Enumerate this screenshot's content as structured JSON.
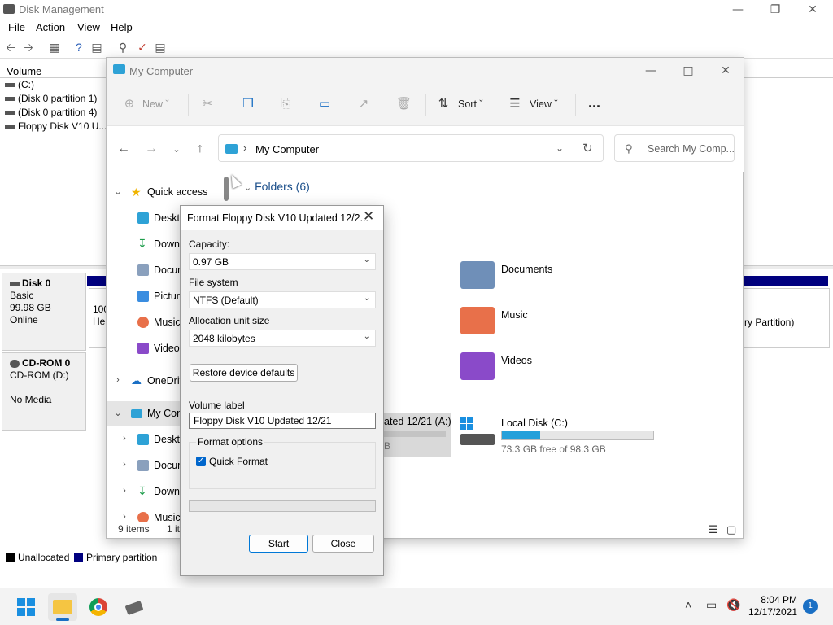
{
  "disk_management": {
    "title": "Disk Management",
    "menu": [
      "File",
      "Action",
      "View",
      "Help"
    ],
    "volume_header": "Volume",
    "volumes": [
      "(C:)",
      "(Disk 0 partition 1)",
      "(Disk 0 partition 4)",
      "Floppy Disk V10 U..."
    ],
    "disks": [
      {
        "name": "Disk 0",
        "type": "Basic",
        "size": "99.98 GB",
        "status": "Online"
      },
      {
        "name": "CD-ROM 0",
        "type": "CD-ROM (D:)",
        "size": "",
        "status": "No Media"
      }
    ],
    "partition_fragment_size": "100",
    "partition_fragment_status": "He",
    "partition_right_label": "ry Partition)",
    "legend": {
      "unallocated": "Unallocated",
      "primary": "Primary partition"
    },
    "colors": {
      "unallocated": "#000000",
      "primary": "#00007f"
    }
  },
  "explorer": {
    "title": "My Computer",
    "commands": {
      "new": "New",
      "sort": "Sort",
      "view": "View",
      "more": "..."
    },
    "address": {
      "location": "My Computer"
    },
    "search_placeholder": "Search My Comp...",
    "nav": [
      {
        "label": "Quick access",
        "icon": "star-icon"
      },
      {
        "label": "Deskto",
        "icon": "desktop-icon"
      },
      {
        "label": "Down",
        "icon": "download-icon"
      },
      {
        "label": "Docum",
        "icon": "document-icon"
      },
      {
        "label": "Pictur",
        "icon": "picture-icon"
      },
      {
        "label": "Music",
        "icon": "music-icon"
      },
      {
        "label": "Videos",
        "icon": "video-icon"
      },
      {
        "label": "OneDrive",
        "icon": "cloud-icon"
      },
      {
        "label": "My Con",
        "icon": "computer-icon"
      },
      {
        "label": "Deskto",
        "icon": "desktop-icon"
      },
      {
        "label": "Docum",
        "icon": "document-icon"
      },
      {
        "label": "Down",
        "icon": "download-icon"
      },
      {
        "label": "Music",
        "icon": "music-icon"
      }
    ],
    "folders_header": "Folders (6)",
    "folders": [
      {
        "name": "Documents",
        "color": "#6f8fb8"
      },
      {
        "name": "Music",
        "color": "#e8704a"
      },
      {
        "name": "Videos",
        "color": "#8a4ac9"
      }
    ],
    "drives": [
      {
        "name": "Local Disk (C:)",
        "free": "73.3 GB free of 98.3 GB",
        "used_fraction": 0.25
      },
      {
        "name_fragment": "ated 12/21 (A:)",
        "free_fragment": "B"
      }
    ],
    "status": {
      "items": "9 items",
      "selected": "1 it"
    }
  },
  "format_dialog": {
    "title": "Format Floppy Disk V10 Updated 12/2...",
    "capacity_label": "Capacity:",
    "capacity_value": "0.97 GB",
    "filesystem_label": "File system",
    "filesystem_value": "NTFS (Default)",
    "alloc_label": "Allocation unit size",
    "alloc_value": "2048 kilobytes",
    "restore_button": "Restore device defaults",
    "volume_label_label": "Volume label",
    "volume_label_value": "Floppy Disk V10 Updated 12/21",
    "format_options_label": "Format options",
    "quick_format_label": "Quick Format",
    "quick_format_checked": true,
    "start_button": "Start",
    "close_button": "Close"
  },
  "taskbar": {
    "time": "8:04 PM",
    "date": "12/17/2021",
    "notification_count": "1"
  }
}
